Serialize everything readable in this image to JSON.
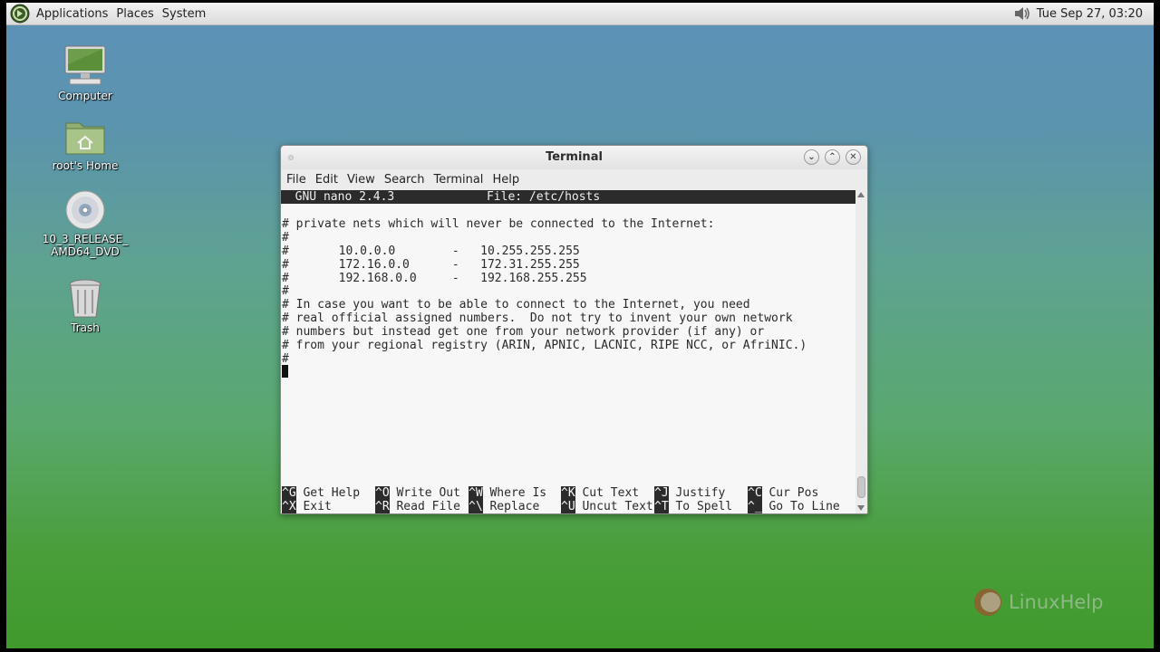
{
  "panel": {
    "menus": [
      "Applications",
      "Places",
      "System"
    ],
    "clock": "Tue Sep 27, 03:20"
  },
  "desktop_icons": [
    {
      "label": "Computer",
      "icon": "computer-icon"
    },
    {
      "label": "root's Home",
      "icon": "home-folder-icon"
    },
    {
      "label": "10_3_RELEASE_\nAMD64_DVD",
      "icon": "dvd-icon"
    },
    {
      "label": "Trash",
      "icon": "trash-icon"
    }
  ],
  "terminal": {
    "title": "Terminal",
    "menus": [
      "File",
      "Edit",
      "View",
      "Search",
      "Terminal",
      "Help"
    ],
    "nano_header": "  GNU nano 2.4.3             File: /etc/hosts",
    "lines": [
      "# private nets which will never be connected to the Internet:",
      "#",
      "#       10.0.0.0        -   10.255.255.255",
      "#       172.16.0.0      -   172.31.255.255",
      "#       192.168.0.0     -   192.168.255.255",
      "#",
      "# In case you want to be able to connect to the Internet, you need",
      "# real official assigned numbers.  Do not try to invent your own network",
      "# numbers but instead get one from your network provider (if any) or",
      "# from your regional registry (ARIN, APNIC, LACNIC, RIPE NCC, or AfriNIC.)",
      "#"
    ],
    "shortcuts_row1": [
      {
        "key": "^G",
        "label": "Get Help"
      },
      {
        "key": "^O",
        "label": "Write Out"
      },
      {
        "key": "^W",
        "label": "Where Is"
      },
      {
        "key": "^K",
        "label": "Cut Text"
      },
      {
        "key": "^J",
        "label": "Justify"
      },
      {
        "key": "^C",
        "label": "Cur Pos"
      }
    ],
    "shortcuts_row2": [
      {
        "key": "^X",
        "label": "Exit"
      },
      {
        "key": "^R",
        "label": "Read File"
      },
      {
        "key": "^\\",
        "label": "Replace"
      },
      {
        "key": "^U",
        "label": "Uncut Text"
      },
      {
        "key": "^T",
        "label": "To Spell"
      },
      {
        "key": "^_",
        "label": "Go To Line"
      }
    ]
  },
  "watermark": "LinuxHelp"
}
